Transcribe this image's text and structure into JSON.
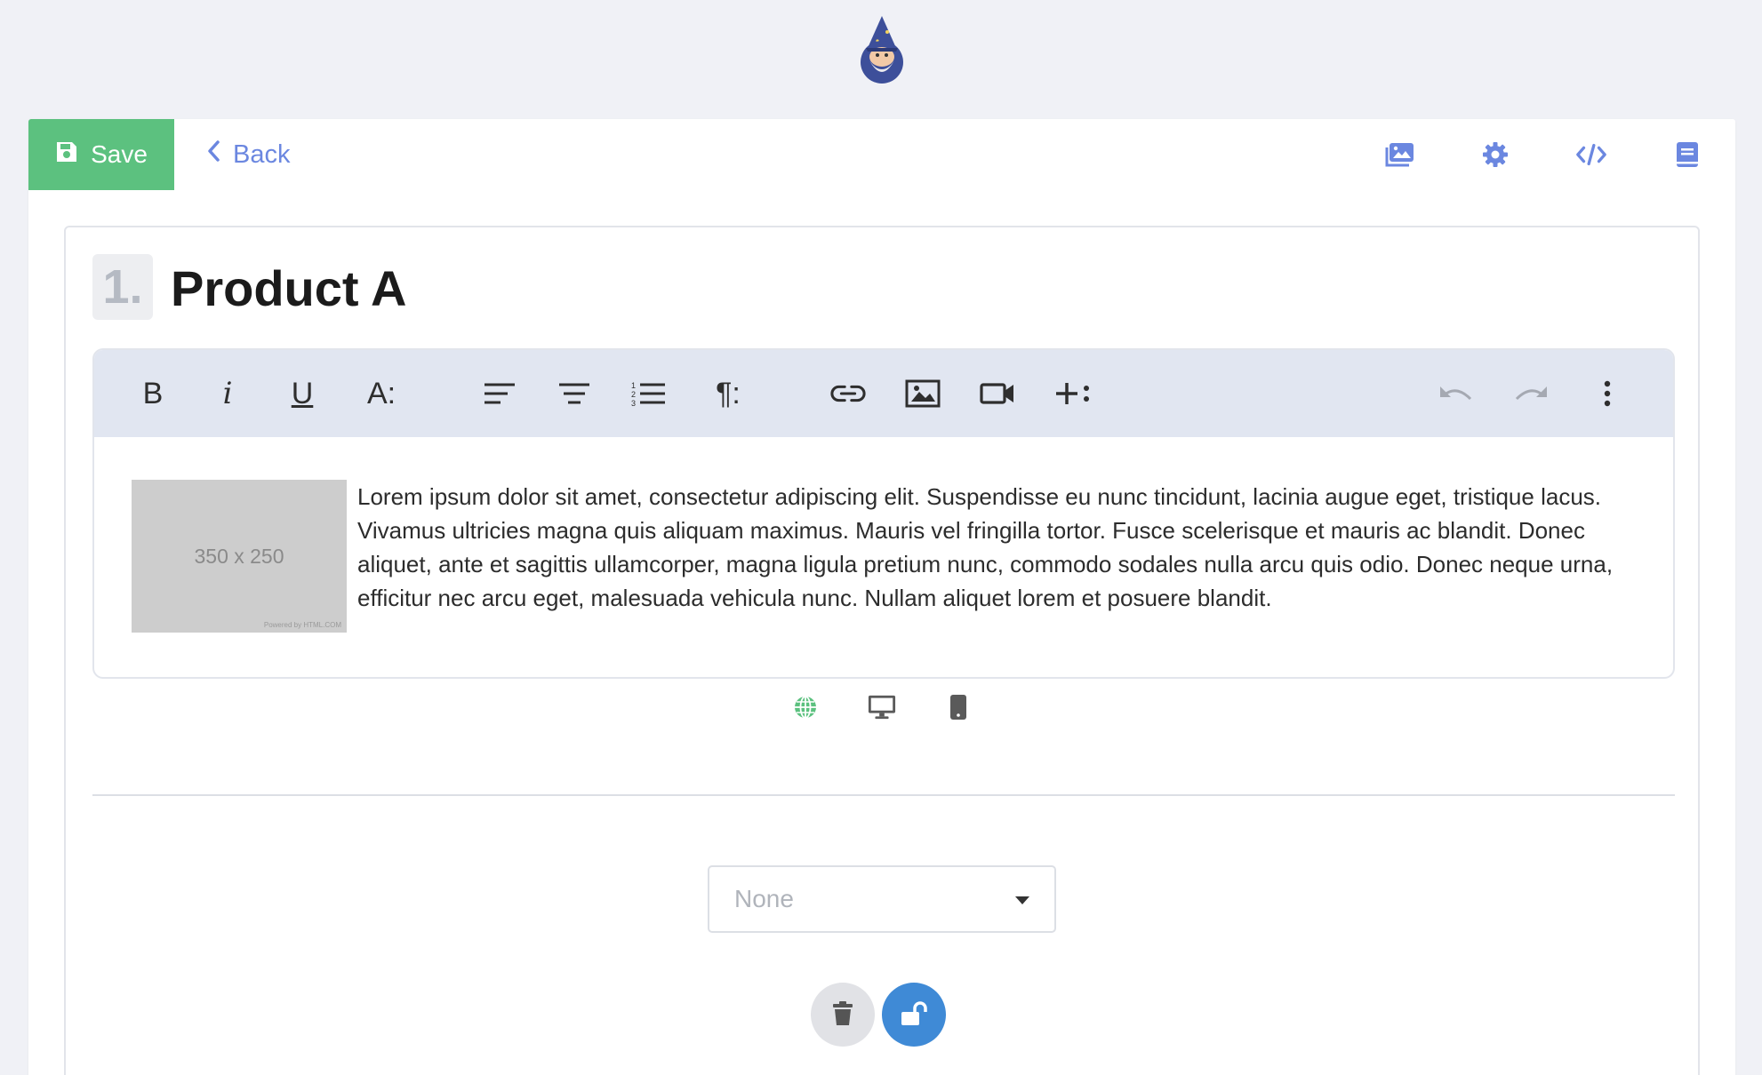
{
  "header": {
    "logo": "wizard-mascot-logo"
  },
  "topbar": {
    "save_label": "Save",
    "back_label": "Back",
    "icons": [
      "gallery-icon",
      "gear-icon",
      "code-icon",
      "book-icon"
    ],
    "accent_color": "#6b87e0",
    "save_color": "#5cc17f"
  },
  "block": {
    "number": "1.",
    "title": "Product A",
    "toolbar": {
      "bold": "B",
      "italic": "i",
      "underline": "U",
      "font_size": "A:",
      "paragraph": "¶:"
    },
    "placeholder_image": {
      "label": "350 x 250",
      "credit": "Powered by HTML.COM"
    },
    "text": "Lorem ipsum dolor sit amet, consectetur adipiscing elit. Suspendisse eu nunc tincidunt, lacinia augue eget, tristique lacus. Vivamus ultricies magna quis aliquam maximus. Mauris vel fringilla tortor. Fusce scelerisque et mauris ac blandit. Donec aliquet, ante et sagittis ullamcorper, magna ligula pretium nunc, commodo sodales nulla arcu quis odio. Donec neque urna, efficitur nec arcu eget, malesuada vehicula nunc. Nullam aliquet lorem et posuere blandit.",
    "visibility": [
      "globe-icon",
      "desktop-icon",
      "mobile-icon"
    ],
    "select_value": "None"
  }
}
